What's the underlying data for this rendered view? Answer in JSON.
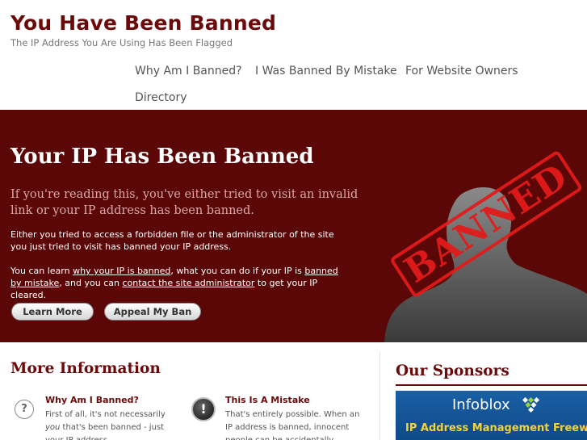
{
  "site": {
    "title": "You Have Been Banned",
    "tagline": "The IP Address You Are Using Has Been Flagged"
  },
  "nav": {
    "items": [
      {
        "label": "Why Am I Banned?"
      },
      {
        "label": "I Was Banned By Mistake"
      },
      {
        "label": "For Website Owners"
      },
      {
        "label": "Directory"
      }
    ]
  },
  "hero": {
    "title": "Your IP Has Been Banned",
    "lead": "If you're reading this, you've either tried to visit an invalid link or your IP address has been banned.",
    "p1": "Either you tried to access a forbidden file or the administrator of the site you just tried to visit has banned your IP address.",
    "p2": {
      "t1": "You can learn ",
      "link1": "why your IP is banned",
      "t2": ", what you can do if your IP is ",
      "link2": "banned by mistake",
      "t3": ", and you can ",
      "link3": "contact the site administrator",
      "t4": " to get your IP cleared."
    },
    "buttons": {
      "learn": "Learn More",
      "appeal": "Appeal My Ban"
    },
    "stamp": "BANNED",
    "colors": {
      "background": "#5c0707",
      "stamp": "#e21b1b"
    }
  },
  "more": {
    "title": "More Information",
    "cards": [
      {
        "icon": "question-icon",
        "icon_glyph": "?",
        "title": "Why Am I Banned?",
        "text_a": "First of all, it's not necessarily ",
        "text_em": "you",
        "text_b": " that's been banned - just your IP address"
      },
      {
        "icon": "exclamation-icon",
        "icon_glyph": "!",
        "title": "This Is A Mistake",
        "text": "That's entirely possible. When an IP address is banned, innocent people can be accidentally"
      }
    ]
  },
  "sponsors": {
    "title": "Our Sponsors",
    "ad": {
      "brand": "Infoblox",
      "tagline": "IP Address Management Freeware",
      "colors": {
        "background": "#1a5fa5",
        "tagline": "#f4d23a"
      }
    }
  }
}
